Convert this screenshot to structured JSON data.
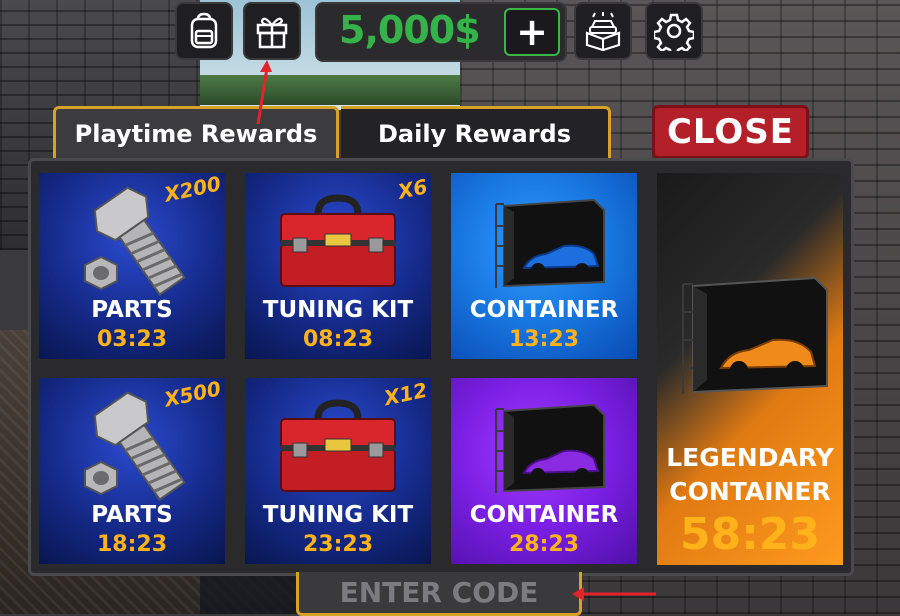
{
  "colors": {
    "accent_gold": "#d8a227",
    "money_green": "#35b34a",
    "close_red": "#b3202a",
    "timer_orange": "#ffb21a",
    "annotation_red": "#e1242a"
  },
  "hud": {
    "icons": [
      "backpack-icon",
      "gift-icon",
      "car-crate-icon",
      "gear-icon"
    ],
    "money": "5,000$",
    "plus_label": "+"
  },
  "tabs": [
    {
      "label": "Playtime Rewards",
      "selected": true
    },
    {
      "label": "Daily Rewards",
      "selected": false
    }
  ],
  "close_label": "CLOSE",
  "rewards": [
    {
      "name": "PARTS",
      "timer": "03:23",
      "quantity": "X200",
      "icon": "bolt-nut-icon"
    },
    {
      "name": "TUNING KIT",
      "timer": "08:23",
      "quantity": "X6",
      "icon": "toolbox-icon"
    },
    {
      "name": "CONTAINER",
      "timer": "13:23",
      "quantity": "",
      "icon": "container-blue-car-icon"
    },
    {
      "name": "PARTS",
      "timer": "18:23",
      "quantity": "X500",
      "icon": "bolt-nut-icon"
    },
    {
      "name": "TUNING KIT",
      "timer": "23:23",
      "quantity": "X12",
      "icon": "toolbox-icon"
    },
    {
      "name": "CONTAINER",
      "timer": "28:23",
      "quantity": "",
      "icon": "container-purple-car-icon"
    }
  ],
  "legendary": {
    "line1": "LEGENDARY",
    "line2": "CONTAINER",
    "timer": "58:23",
    "icon": "container-orange-car-icon"
  },
  "enter_code_label": "ENTER CODE"
}
